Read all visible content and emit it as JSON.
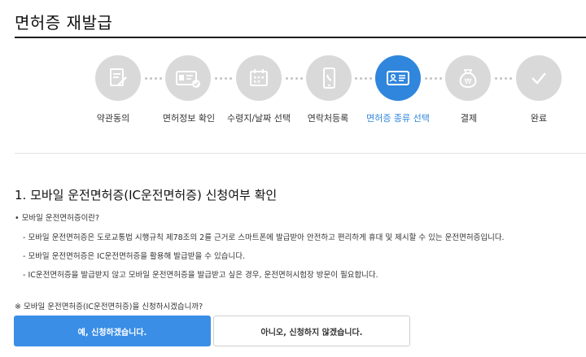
{
  "page": {
    "title": "면허증 재발급"
  },
  "steps": [
    {
      "label": "약관동의",
      "icon": "document-edit-icon",
      "active": false
    },
    {
      "label": "면허정보 확인",
      "icon": "id-card-check-icon",
      "active": false
    },
    {
      "label": "수령지/날짜 선택",
      "icon": "calendar-icon",
      "active": false
    },
    {
      "label": "연락처등록",
      "icon": "smartphone-icon",
      "active": false
    },
    {
      "label": "면허증 종류 선택",
      "icon": "id-card-icon",
      "active": true
    },
    {
      "label": "결제",
      "icon": "money-bag-icon",
      "active": false
    },
    {
      "label": "완료",
      "icon": "checkmark-icon",
      "active": false
    }
  ],
  "section": {
    "heading": "1. 모바일 운전면허증(IC운전면허증) 신청여부 확인",
    "question": "• 모바일 운전면허증이란?",
    "info": [
      "- 모바일 운전면허증은 도로교통법 시행규칙 제78조의 2를 근거로 스마트폰에 발급받아 안전하고 편리하게 휴대 및 제시할 수 있는 운전면허증입니다.",
      "- 모바일 운전면허증은 IC운전면허증을 활용해 발급받을 수 있습니다.",
      "- IC운전면허증을 발급받지 않고 모바일 운전면허증을 발급받고 싶은 경우, 운전면허시험장 방문이 필요합니다."
    ],
    "prompt": "※ 모바일 운전면허증(IC운전면허증)을 신청하시겠습니까?"
  },
  "buttons": {
    "yes": "예, 신청하겠습니다.",
    "no": "아니오, 신청하지 않겠습니다."
  },
  "colors": {
    "accent": "#2f86dc",
    "inactive_step": "#d9d9d9"
  }
}
